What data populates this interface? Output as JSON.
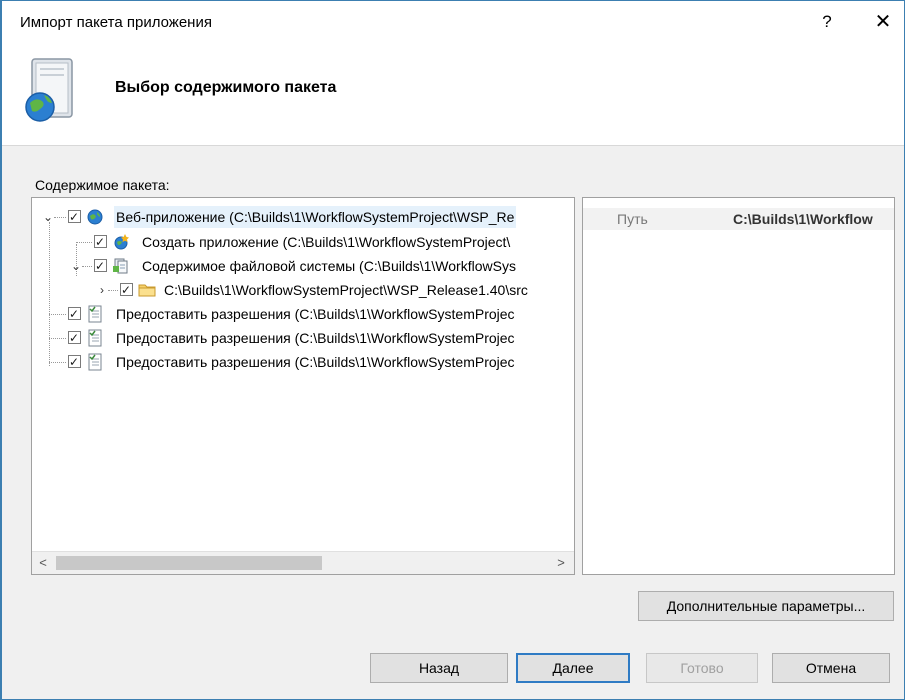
{
  "window": {
    "title": "Импорт пакета приложения",
    "help_glyph": "?",
    "close_glyph": "✕"
  },
  "header": {
    "title": "Выбор содержимого пакета",
    "icon": "package-globe-icon"
  },
  "content": {
    "label": "Содержимое пакета:"
  },
  "tree": {
    "items": [
      {
        "label": "Веб-приложение (C:\\Builds\\1\\WorkflowSystemProject\\WSP_Re",
        "icon": "globe-icon",
        "expanded": true,
        "checked": true
      },
      {
        "label": "Создать приложение (C:\\Builds\\1\\WorkflowSystemProject\\",
        "icon": "create-app-icon",
        "checked": true
      },
      {
        "label": "Содержимое файловой системы (C:\\Builds\\1\\WorkflowSys",
        "icon": "file-system-icon",
        "expanded": true,
        "checked": true
      },
      {
        "label": "C:\\Builds\\1\\WorkflowSystemProject\\WSP_Release1.40\\src",
        "icon": "folder-icon",
        "expanded": false,
        "checked": true
      },
      {
        "label": "Предоставить разрешения (C:\\Builds\\1\\WorkflowSystemProjec",
        "icon": "permissions-icon",
        "checked": true
      },
      {
        "label": "Предоставить разрешения (C:\\Builds\\1\\WorkflowSystemProjec",
        "icon": "permissions-icon",
        "checked": true
      },
      {
        "label": "Предоставить разрешения (C:\\Builds\\1\\WorkflowSystemProjec",
        "icon": "permissions-icon",
        "checked": true
      }
    ],
    "scroll_left": "<",
    "scroll_right": ">"
  },
  "properties": {
    "name": "Путь",
    "value": "C:\\Builds\\1\\Workflow"
  },
  "buttons": {
    "advanced": "Дополнительные параметры...",
    "back": "Назад",
    "next": "Далее",
    "finish": "Готово",
    "cancel": "Отмена"
  },
  "colors": {
    "window_border": "#3c7fb1",
    "default_button_border": "#2f7bc4",
    "selection": "#e5f1fb"
  }
}
